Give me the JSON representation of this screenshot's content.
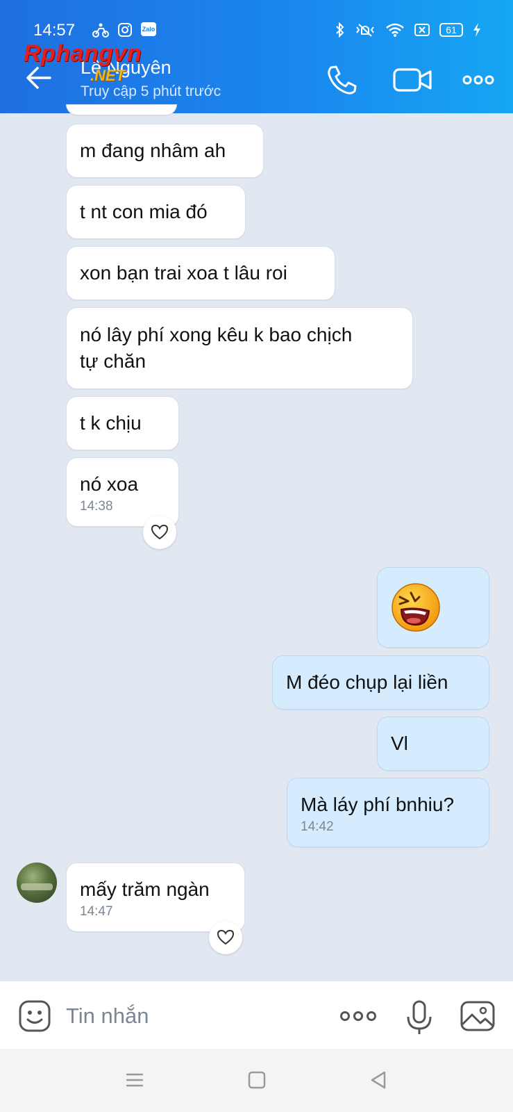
{
  "status_bar": {
    "time": "14:57",
    "battery": "61",
    "icons": [
      "motorbike-icon",
      "instagram-icon",
      "zalo-icon",
      "bluetooth-icon",
      "vibrate-icon",
      "wifi-icon",
      "sim-icon",
      "battery-icon",
      "charging-icon"
    ]
  },
  "header": {
    "contact_name": "Lê Nguyên",
    "contact_status": "Truy cập 5 phút trước",
    "watermark_text": "Rphangvn",
    "watermark_suffix": ".NET",
    "accent_color": "#1a86ee"
  },
  "messages": [
    {
      "text": "m đang nhâm ah",
      "time": "",
      "side": "received"
    },
    {
      "text": "t nt con mia đó",
      "time": "",
      "side": "received"
    },
    {
      "text": "xon bạn trai xoa t lâu roi",
      "time": "",
      "side": "received"
    },
    {
      "text": "nó lây phí xong kêu k bao chịch\ntự chăn",
      "time": "",
      "side": "received"
    },
    {
      "text": "t k chịu",
      "time": "",
      "side": "received"
    },
    {
      "text": "nó xoa",
      "time": "14:38",
      "side": "received"
    },
    {
      "text": "",
      "emoji": "laughing-face-icon",
      "time": "",
      "side": "sent"
    },
    {
      "text": "M đéo chụp lại liền",
      "time": "",
      "side": "sent"
    },
    {
      "text": "Vl",
      "time": "",
      "side": "sent"
    },
    {
      "text": "Mà láy phí bnhiu?",
      "time": "14:42",
      "side": "sent"
    },
    {
      "text": "mấy trăm ngàn",
      "time": "14:47",
      "side": "received"
    }
  ],
  "composer": {
    "placeholder": "Tin nhắn"
  }
}
